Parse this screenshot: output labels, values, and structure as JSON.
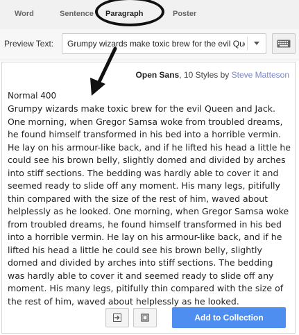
{
  "tabs": [
    {
      "label": "Word",
      "active": false
    },
    {
      "label": "Sentence",
      "active": false
    },
    {
      "label": "Paragraph",
      "active": true
    },
    {
      "label": "Poster",
      "active": false
    }
  ],
  "preview": {
    "label": "Preview Text:",
    "value": "Grumpy wizards make toxic brew for the evil Queen and Jack."
  },
  "font": {
    "name": "Open Sans",
    "styles": ", 10 Styles by ",
    "author": "Steve Matteson"
  },
  "sample": {
    "style_label": "Normal 400",
    "paragraph": "Grumpy wizards make toxic brew for the evil Queen and Jack. One morning, when Gregor Samsa woke from troubled dreams, he found himself transformed in his bed into a horrible vermin. He lay on his armour-like back, and if he lifted his head a little he could see his brown belly, slightly domed and divided by arches into stiff sections. The bedding was hardly able to cover it and seemed ready to slide off any moment. His many legs, pitifully thin compared with the size of the rest of him, waved about helplessly as he looked. One morning, when Gregor Samsa woke from troubled dreams, he found himself transformed in his bed into a horrible vermin. He lay on his armour-like back, and if he lifted his head a little he could see his brown belly, slightly domed and divided by arches into stiff sections. The bedding was hardly able to cover it and seemed ready to slide off any moment. His many legs, pitifully thin compared with the size of the rest of him, waved about helplessly as he looked."
  },
  "actions": {
    "add_label": "Add to Collection",
    "goto_icon": "arrow-right-box-icon",
    "copy_icon": "square-icon"
  },
  "colors": {
    "accent": "#4d8ef0",
    "author_link": "#7a86c8"
  }
}
